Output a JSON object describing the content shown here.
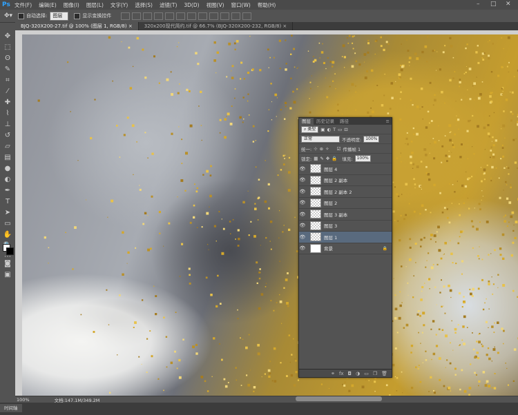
{
  "app": {
    "logo": "Ps"
  },
  "menu": [
    "文件(F)",
    "编辑(E)",
    "图像(I)",
    "图层(L)",
    "文字(Y)",
    "选择(S)",
    "滤镜(T)",
    "3D(D)",
    "视图(V)",
    "窗口(W)",
    "帮助(H)"
  ],
  "window_controls": [
    "–",
    "□",
    "✕"
  ],
  "options": {
    "auto_select_label": "自动选择:",
    "auto_select_value": "图层",
    "show_transform_label": "显示变换控件"
  },
  "tabs": [
    {
      "label": "BJQ-320X200-27.tif @ 100% (图层 1, RGB/8) ×",
      "active": true
    },
    {
      "label": "320x200现代简约.tif @ 66.7% (BJQ-320X200-232, RGB/8) ×",
      "active": false
    }
  ],
  "tools": [
    "move-tool",
    "marquee-tool",
    "lasso-tool",
    "quick-select-tool",
    "crop-tool",
    "eyedropper-tool",
    "healing-tool",
    "brush-tool",
    "stamp-tool",
    "history-brush-tool",
    "eraser-tool",
    "gradient-tool",
    "blur-tool",
    "dodge-tool",
    "pen-tool",
    "type-tool",
    "path-select-tool",
    "shape-tool",
    "hand-tool",
    "zoom-tool"
  ],
  "layers_panel": {
    "tabs": [
      "图层",
      "历史记录",
      "路径"
    ],
    "filter_value": "类型",
    "blend_mode": "正常",
    "opacity_label": "不透明度:",
    "opacity_value": "100%",
    "unify_label": "统一:",
    "propagate_label": "传播帧 1",
    "lock_label": "锁定:",
    "fill_label": "填充:",
    "fill_value": "100%",
    "layers": [
      {
        "name": "图层 4",
        "selected": false,
        "thumb": "transparent",
        "locked": false
      },
      {
        "name": "图层 2 副本",
        "selected": false,
        "thumb": "transparent",
        "locked": false
      },
      {
        "name": "图层 2 副本 2",
        "selected": false,
        "thumb": "transparent",
        "locked": false
      },
      {
        "name": "图层 2",
        "selected": false,
        "thumb": "transparent",
        "locked": false
      },
      {
        "name": "图层 3 副本",
        "selected": false,
        "thumb": "transparent",
        "locked": false
      },
      {
        "name": "图层 3",
        "selected": false,
        "thumb": "transparent",
        "locked": false
      },
      {
        "name": "图层 1",
        "selected": true,
        "thumb": "transparent",
        "locked": false
      },
      {
        "name": "背景",
        "selected": false,
        "thumb": "white",
        "locked": true
      }
    ],
    "footer_icons": [
      "link-icon",
      "fx-icon",
      "mask-icon",
      "adjustment-icon",
      "folder-icon",
      "new-layer-icon",
      "trash-icon"
    ]
  },
  "status": {
    "zoom": "100%",
    "doc_info": "文档:147.1M/349.2M"
  },
  "timeline": {
    "label": "时间轴"
  },
  "colors": {
    "glitter_gold": "#d4a82c",
    "selected_layer": "#596a7e",
    "ps_blue": "#2fa3ff"
  }
}
